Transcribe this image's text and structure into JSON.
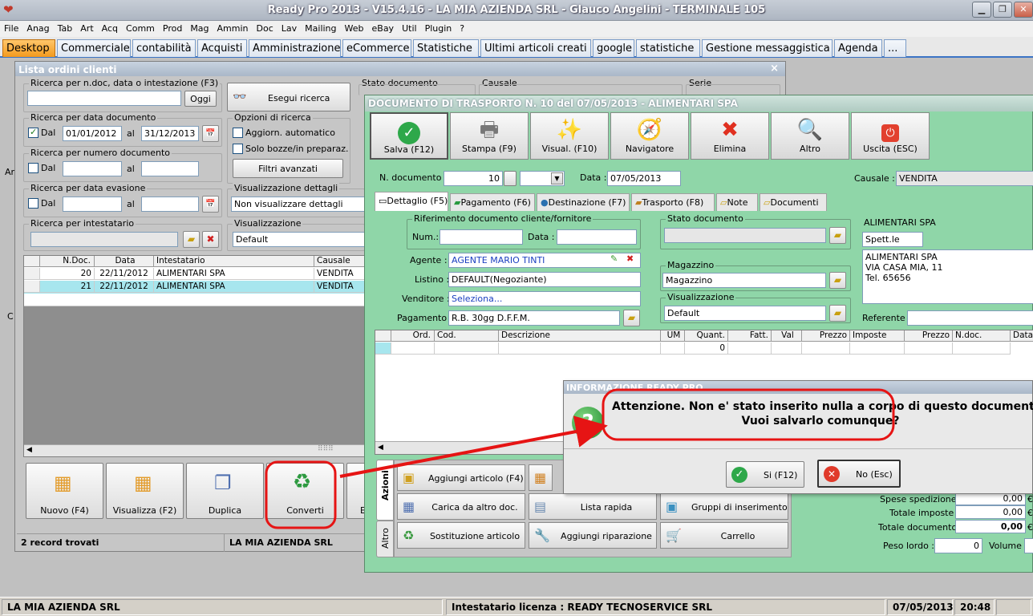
{
  "window": {
    "title": "Ready Pro 2013 - V15.4.16 - LA MIA AZIENDA SRL - Glauco Angelini - TERMINALE 105"
  },
  "menu": [
    "File",
    "Anag",
    "Tab",
    "Art",
    "Acq",
    "Comm",
    "Prod",
    "Mag",
    "Ammin",
    "Doc",
    "Lav",
    "Mailing",
    "Web",
    "eBay",
    "Util",
    "Plugin",
    "?"
  ],
  "tabs": [
    "Desktop",
    "Commerciale",
    "contabilità",
    "Acquisti",
    "Amministrazione",
    "eCommerce",
    "Statistiche",
    "Ultimi articoli creati",
    "google",
    "statistiche",
    "Gestione messaggistica",
    "Agenda",
    "..."
  ],
  "orders": {
    "title": "Lista ordini clienti",
    "close": "×",
    "search_text": {
      "label": "Ricerca per n.doc, data o intestazione (F3)",
      "value": "",
      "button": "Oggi"
    },
    "run_search": "Esegui ricerca",
    "doc_date": {
      "label": "Ricerca per data documento",
      "dal": "Dal",
      "from": "01/01/2012",
      "al": "al",
      "to": "31/12/2013"
    },
    "doc_number": {
      "label": "Ricerca per numero documento",
      "dal": "Dal",
      "al": "al"
    },
    "evasion": {
      "label": "Ricerca per data evasione",
      "dal": "Dal",
      "al": "al"
    },
    "holder": {
      "label": "Ricerca per intestatario"
    },
    "options": {
      "label": "Opzioni di ricerca",
      "auto": "Aggiorn. automatico",
      "drafts": "Solo bozze/in preparaz.",
      "filters": "Filtri avanzati"
    },
    "detail_view": {
      "label": "Visualizzazione dettagli",
      "value": "Non visualizzare dettagli"
    },
    "view": {
      "label": "Visualizzazione",
      "value": "Default"
    },
    "stato_label": "Stato documento",
    "causale_label": "Causale",
    "serie_label": "Serie",
    "columns": [
      "N.Doc.",
      "Data",
      "Intestatario",
      "Causale"
    ],
    "rows": [
      {
        "n": "20",
        "date": "22/11/2012",
        "holder": "ALIMENTARI SPA",
        "causale": "VENDITA"
      },
      {
        "n": "21",
        "date": "22/11/2012",
        "holder": "ALIMENTARI SPA",
        "causale": "VENDITA"
      }
    ],
    "actions": [
      "Nuovo (F4)",
      "Visualizza (F2)",
      "Duplica",
      "Converti",
      "E"
    ],
    "records": "2 record trovati",
    "company": "LA MIA AZIENDA SRL",
    "side_a": "Ar",
    "side_c": "C"
  },
  "ddt": {
    "title": "DOCUMENTO DI TRASPORTO N. 10 del 07/05/2013 - ALIMENTARI SPA",
    "toolbar": [
      "Salva (F12)",
      "Stampa (F9)",
      "Visual. (F10)",
      "Navigatore",
      "Elimina",
      "Altro",
      "Uscita (ESC)"
    ],
    "ndoc_label": "N. documento :",
    "ndoc_value": "10",
    "date_label": "Data :",
    "date_value": "07/05/2013",
    "causale_label": "Causale :",
    "causale_value": "VENDITA",
    "subtabs": [
      "Dettaglio (F5)",
      "Pagamento (F6)",
      "Destinazione (F7)",
      "Trasporto (F8)",
      "Note",
      "Documenti"
    ],
    "ref_group": "Riferimento documento cliente/fornitore",
    "num_label": "Num.:",
    "data_label": "Data :",
    "agent_label": "Agente :",
    "agent_value": "AGENTE MARIO TINTI",
    "list_label": "Listino :",
    "list_value": "DEFAULT(Negoziante)",
    "seller_label": "Venditore :",
    "seller_value": "Seleziona...",
    "pay_label": "Pagamento :",
    "pay_value": "R.B. 30gg D.F.F.M.",
    "stato_label": "Stato documento",
    "mag_label": "Magazzino",
    "mag_value": "Magazzino",
    "vis_label": "Visualizzazione",
    "vis_value": "Default",
    "customer_name": "ALIMENTARI SPA",
    "spett": "Spett.le",
    "address": [
      "ALIMENTARI SPA",
      "VIA CASA MIA, 11",
      "Tel. 65656"
    ],
    "referente": "Referente",
    "grid_cols": [
      "Ord.",
      "Cod.",
      "Descrizione",
      "UM",
      "Quant.",
      "Fatt.",
      "Val",
      "Prezzo",
      "Imposte",
      "Prezzo",
      "N.doc.",
      "Data"
    ],
    "grid_qty": "0",
    "side_tabs": [
      "Azioni",
      "Altro"
    ],
    "actions": [
      "Aggiungi articolo (F4)",
      "Carica da altro doc.",
      "Lista rapida",
      "Gruppi di inserimento",
      "Sostituzione articolo",
      "Aggiungi riparazione",
      "Carrello"
    ],
    "totals": [
      {
        "label": "Spese spedizione :",
        "value": "0,00",
        "cur": "€"
      },
      {
        "label": "Totale imposte :",
        "value": "0,00",
        "cur": "€"
      },
      {
        "label": "Totale documento :",
        "value": "0,00",
        "cur": "€"
      }
    ],
    "weight_label": "Peso lordo :",
    "weight_value": "0",
    "volume_label": "Volume :"
  },
  "dialog": {
    "title": "INFORMAZIONE READY PRO",
    "message1": "Attenzione. Non e' stato inserito nulla a corpo di questo documento.",
    "message2": "Vuoi salvarlo comunque?",
    "yes": "Si (F12)",
    "no": "No (Esc)"
  },
  "status": {
    "company": "LA MIA AZIENDA SRL",
    "license": "Intestatario licenza : READY TECNOSERVICE SRL",
    "date": "07/05/2013",
    "time": "20:48"
  },
  "colors": {
    "accent": "#3b74c5",
    "highlight": "#e61414",
    "ddt_bg": "#8fd6a8",
    "row_sel": "#a7e6ee"
  }
}
